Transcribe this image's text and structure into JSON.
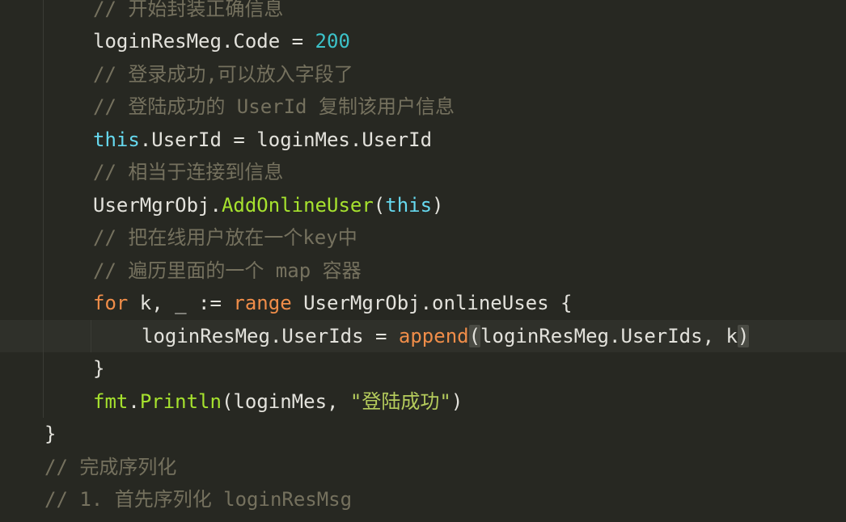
{
  "editor": {
    "lines": [
      {
        "tokens": [
          {
            "t": "cm",
            "v": "// 开始封装正确信息"
          }
        ]
      },
      {
        "tokens": [
          {
            "t": "plain",
            "v": "loginResMeg.Code = "
          },
          {
            "t": "num",
            "v": "200"
          }
        ]
      },
      {
        "tokens": [
          {
            "t": "cm",
            "v": "// 登录成功,可以放入字段了"
          }
        ]
      },
      {
        "tokens": [
          {
            "t": "cm",
            "v": "// 登陆成功的 UserId 复制该用户信息"
          }
        ]
      },
      {
        "tokens": [
          {
            "t": "kw",
            "v": "this"
          },
          {
            "t": "plain",
            "v": ".UserId = loginMes.UserId"
          }
        ]
      },
      {
        "tokens": [
          {
            "t": "cm",
            "v": "// 相当于连接到信息"
          }
        ]
      },
      {
        "tokens": [
          {
            "t": "plain",
            "v": "UserMgrObj."
          },
          {
            "t": "fn",
            "v": "AddOnlineUser"
          },
          {
            "t": "plain",
            "v": "("
          },
          {
            "t": "kw",
            "v": "this"
          },
          {
            "t": "plain",
            "v": ")"
          }
        ]
      },
      {
        "tokens": [
          {
            "t": "cm",
            "v": "// 把在线用户放在一个key中"
          }
        ]
      },
      {
        "tokens": [
          {
            "t": "cm",
            "v": "// 遍历里面的一个 map 容器"
          }
        ]
      },
      {
        "tokens": [
          {
            "t": "ctrl",
            "v": "for"
          },
          {
            "t": "plain",
            "v": " k, _ := "
          },
          {
            "t": "ctrl",
            "v": "range"
          },
          {
            "t": "plain",
            "v": " UserMgrObj.onlineUses {"
          }
        ]
      },
      {
        "tokens": [
          {
            "t": "plain",
            "v": "loginResMeg.UserIds = "
          },
          {
            "t": "ctrl",
            "v": "append"
          },
          {
            "t": "bm",
            "v": "("
          },
          {
            "t": "plain",
            "v": "loginResMeg.UserIds, k"
          },
          {
            "t": "bm",
            "v": ")"
          }
        ]
      },
      {
        "tokens": [
          {
            "t": "plain",
            "v": "}"
          }
        ]
      },
      {
        "tokens": [
          {
            "t": "fn",
            "v": "fmt"
          },
          {
            "t": "plain",
            "v": "."
          },
          {
            "t": "fn",
            "v": "Println"
          },
          {
            "t": "plain",
            "v": "(loginMes, "
          },
          {
            "t": "str",
            "v": "\"登陆成功\""
          },
          {
            "t": "plain",
            "v": ")"
          }
        ]
      },
      {
        "tokens": [
          {
            "t": "plain",
            "v": "}"
          }
        ]
      },
      {
        "tokens": [
          {
            "t": "cm",
            "v": "// 完成序列化"
          }
        ]
      },
      {
        "tokens": [
          {
            "t": "cm",
            "v": "// 1. 首先序列化 loginResMsg"
          }
        ]
      }
    ]
  }
}
